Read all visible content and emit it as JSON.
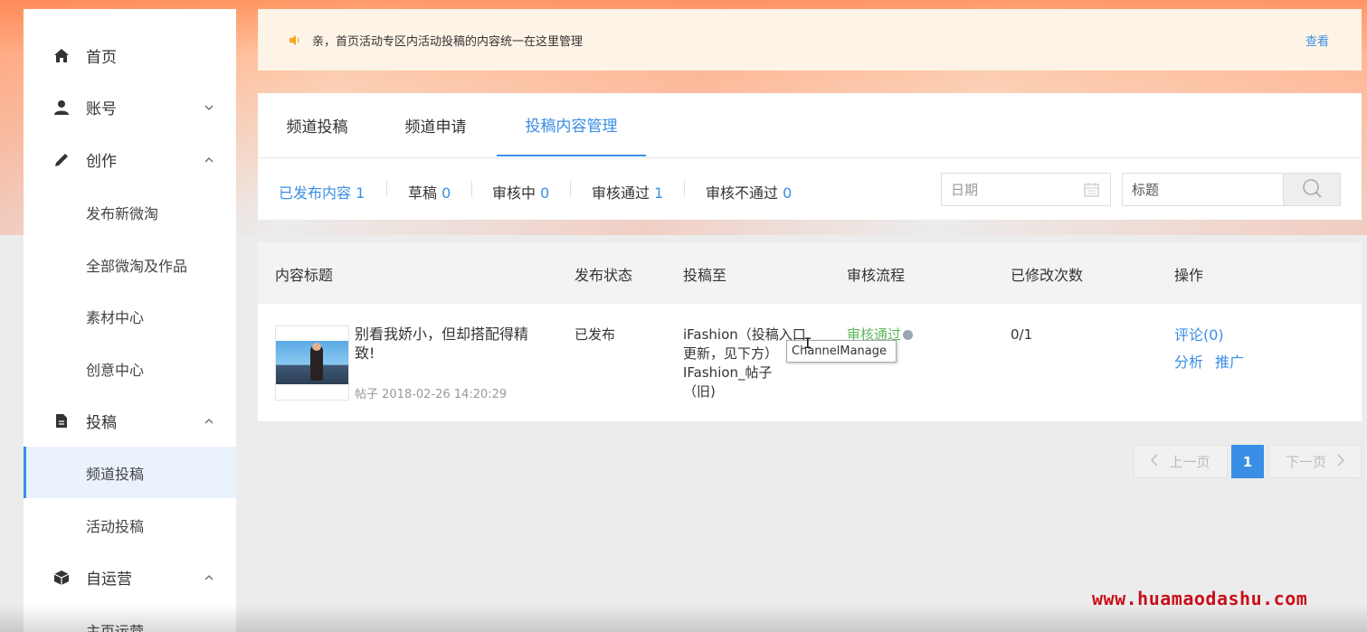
{
  "sidebar": {
    "items": [
      {
        "label": "首页",
        "icon": "home-icon"
      },
      {
        "label": "账号",
        "icon": "user-icon",
        "chevron": "⌄"
      },
      {
        "label": "创作",
        "icon": "pencil-icon",
        "chevron": "⌃"
      },
      {
        "label": "发布新微淘"
      },
      {
        "label": "全部微淘及作品"
      },
      {
        "label": "素材中心"
      },
      {
        "label": "创意中心"
      },
      {
        "label": "投稿",
        "icon": "document-icon",
        "chevron": "⌃"
      },
      {
        "label": "频道投稿",
        "active": true
      },
      {
        "label": "活动投稿"
      },
      {
        "label": "自运营",
        "icon": "cube-icon",
        "chevron": "⌃"
      },
      {
        "label": "主页运营"
      }
    ]
  },
  "notice": {
    "message": "亲，首页活动专区内活动投稿的内容统一在这里管理",
    "view_label": "查看"
  },
  "tabs": [
    {
      "label": "频道投稿"
    },
    {
      "label": "频道申请"
    },
    {
      "label": "投稿内容管理",
      "active": true
    }
  ],
  "filters": [
    {
      "label": "已发布内容",
      "count": "1",
      "active": true
    },
    {
      "label": "草稿",
      "count": "0"
    },
    {
      "label": "审核中",
      "count": "0"
    },
    {
      "label": "审核通过",
      "count": "1"
    },
    {
      "label": "审核不通过",
      "count": "0"
    }
  ],
  "search": {
    "date_placeholder": "日期",
    "title_placeholder": "标题"
  },
  "table": {
    "headers": [
      "内容标题",
      "发布状态",
      "投稿至",
      "审核流程",
      "已修改次数",
      "操作"
    ],
    "rows": [
      {
        "title": "别看我娇小，但却搭配得精致!",
        "meta": "帖子 2018-02-26 14:20:29",
        "status": "已发布",
        "target_line1": "iFashion（投稿入口",
        "target_line2": "更新，见下方）",
        "target_line3": "IFashion_帖子",
        "target_line4": "（旧)",
        "audit": "审核通过",
        "modified": "0/1",
        "action_comment": "评论(0)",
        "action_analyze": "分析",
        "action_promote": "推广"
      }
    ]
  },
  "tooltip": "ChannelManage",
  "pagination": {
    "prev": "上一页",
    "current": "1",
    "next": "下一页"
  },
  "watermark": "www.huamaodashu.com",
  "colors": {
    "accent": "#3a8ee6",
    "success": "#5cb85c",
    "watermark": "#c8101a"
  }
}
